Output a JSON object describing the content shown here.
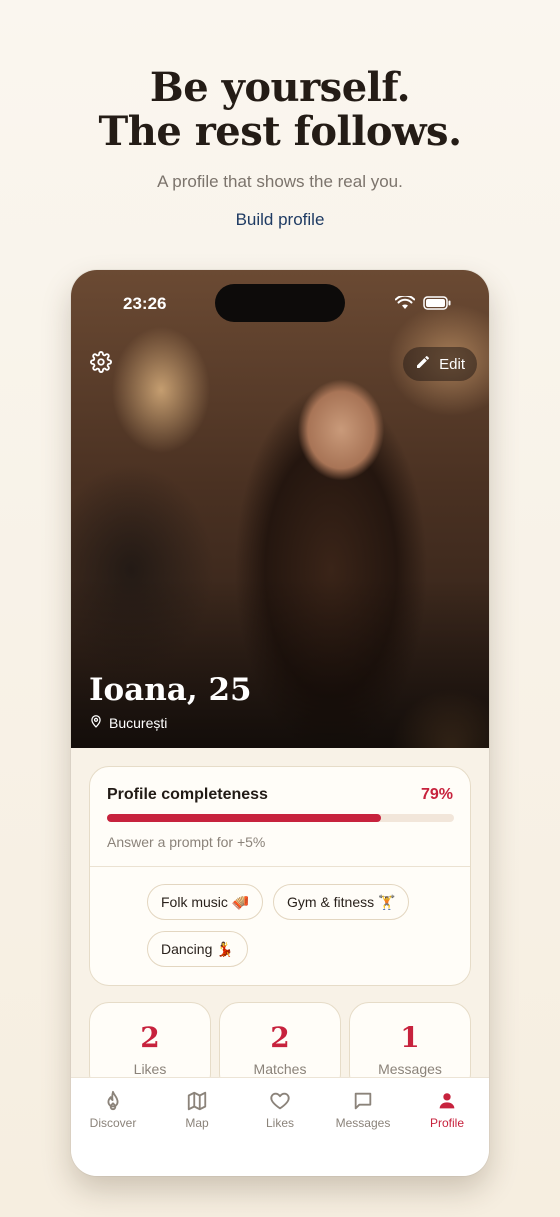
{
  "hero": {
    "title_line1": "Be yourself.",
    "title_line2": "The rest follows.",
    "subtitle": "A profile that shows the real you.",
    "link": "Build profile"
  },
  "phone": {
    "status_time": "23:26",
    "edit_label": "Edit",
    "profile": {
      "name_age": "Ioana, 25",
      "location": "București"
    },
    "completeness": {
      "title": "Profile completeness",
      "percent_label": "79%",
      "percent_value": 0.79,
      "hint": "Answer a prompt for +5%"
    },
    "interests": [
      {
        "label": "Folk music 🪗"
      },
      {
        "label": "Gym & fitness 🏋️"
      },
      {
        "label": "Dancing 💃"
      }
    ],
    "stats": [
      {
        "value": "2",
        "label": "Likes"
      },
      {
        "value": "2",
        "label": "Matches"
      },
      {
        "value": "1",
        "label": "Messages"
      }
    ],
    "tabs": [
      {
        "label": "Discover",
        "icon": "flame-icon"
      },
      {
        "label": "Map",
        "icon": "map-icon"
      },
      {
        "label": "Likes",
        "icon": "heart-icon"
      },
      {
        "label": "Messages",
        "icon": "chat-icon"
      },
      {
        "label": "Profile",
        "icon": "person-icon",
        "active": true
      }
    ]
  },
  "colors": {
    "accent": "#c7223d",
    "link": "#1f3b63",
    "background": "#faf6ef"
  }
}
